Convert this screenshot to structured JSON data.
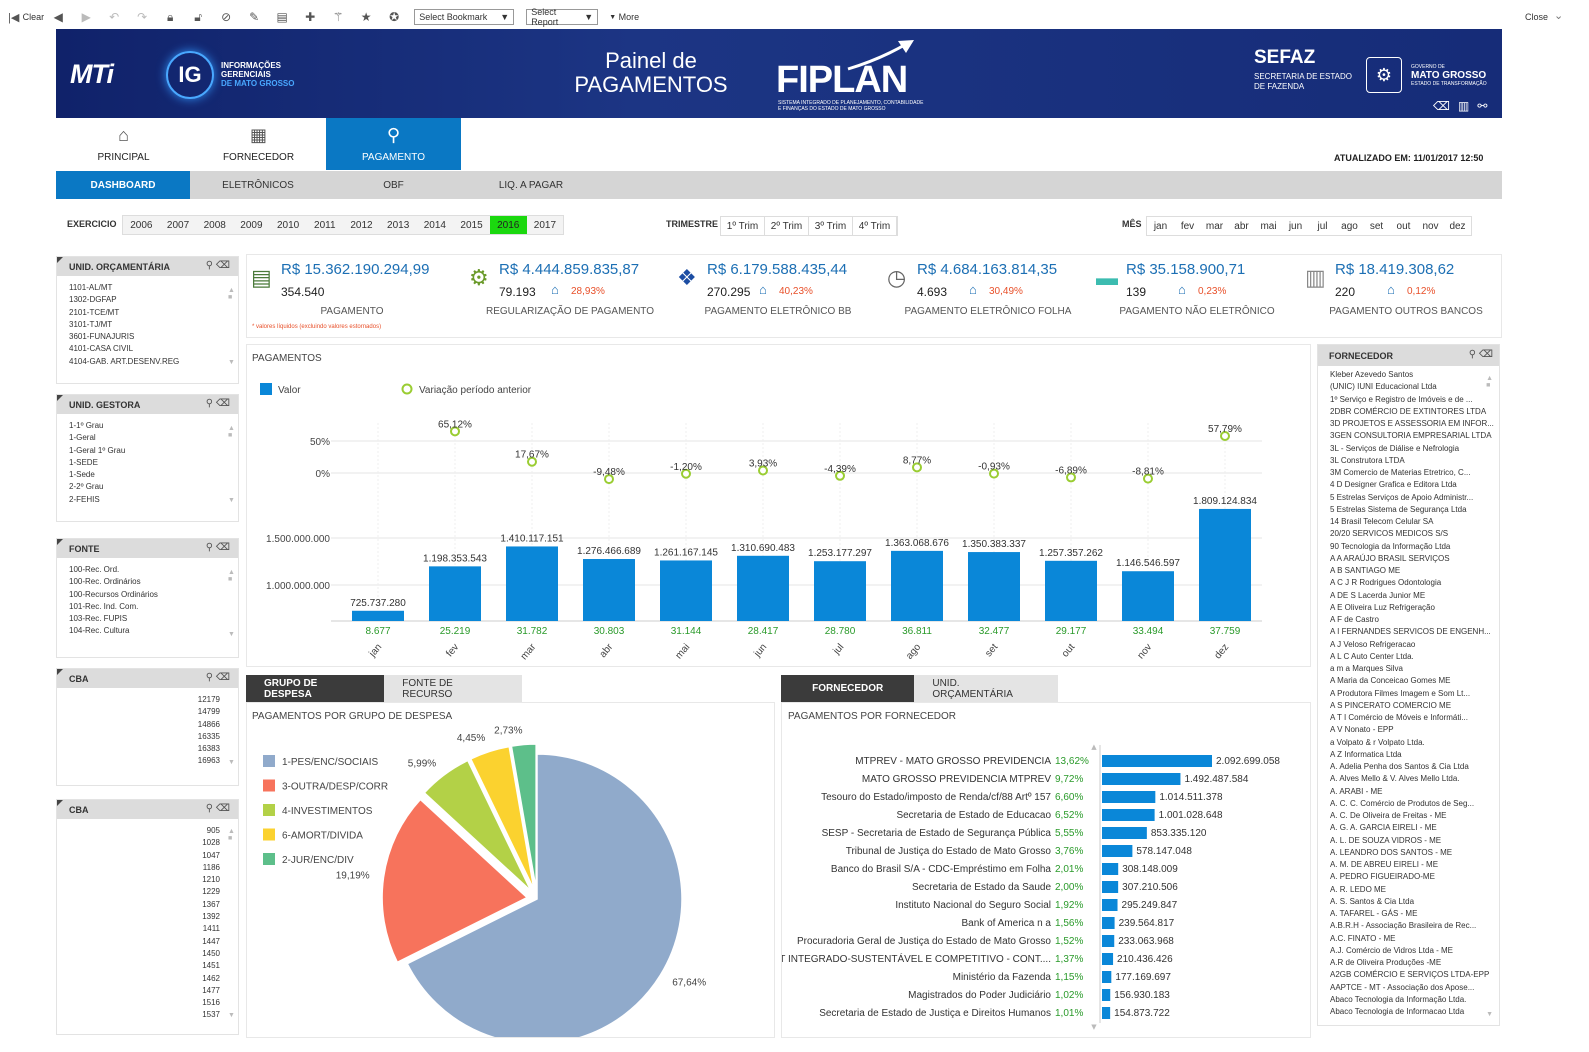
{
  "toolbar": {
    "clear_label": "Clear",
    "bookmark_select": "Select Bookmark",
    "report_select": "Select Report",
    "more_label": "More",
    "close_label": "Close"
  },
  "header": {
    "logo_text": "MTi",
    "ig_text": "IG",
    "ig_sub": [
      "INFORMAÇÕES",
      "GERENCIAIS",
      "DE MATO GROSSO"
    ],
    "title_line1": "Painel de",
    "title_line2": "PAGAMENTOS",
    "fiplan": "FIPLAN",
    "fiplan_sub": "SISTEMA INTEGRADO DE PLANEJAMENTO, CONTABILIDADE E FINANÇAS DO ESTADO DE MATO GROSSO",
    "sefaz": "SEFAZ",
    "sefaz_sub1": "SECRETARIA DE ESTADO",
    "sefaz_sub2": "DE FAZENDA",
    "mt_line1": "GOVERNO DE",
    "mt_line2": "MATO GROSSO",
    "mt_line3": "ESTADO DE TRANSFORMAÇÃO"
  },
  "nav": {
    "tabs": [
      {
        "label": "PRINCIPAL",
        "icon": "home-icon"
      },
      {
        "label": "FORNECEDOR",
        "icon": "building-icon"
      },
      {
        "label": "PAGAMENTO",
        "icon": "payment-icon"
      }
    ],
    "active": 2
  },
  "updated": "ATUALIZADO EM: 11/01/2017 12:50",
  "subnav": {
    "tabs": [
      "DASHBOARD",
      "ELETRÔNICOS",
      "OBF",
      "LIQ. A PAGAR"
    ],
    "active": 0
  },
  "filters": {
    "exercicio_label": "EXERCICIO",
    "years": [
      "2006",
      "2007",
      "2008",
      "2009",
      "2010",
      "2011",
      "2012",
      "2013",
      "2014",
      "2015",
      "2016",
      "2017"
    ],
    "selected_year": "2016",
    "trimestre_label": "TRIMESTRE",
    "trimestres": [
      "1º Trim",
      "2º Trim",
      "3º Trim",
      "4º Trim"
    ],
    "mes_label": "MÊS",
    "meses": [
      "jan",
      "fev",
      "mar",
      "abr",
      "mai",
      "jun",
      "jul",
      "ago",
      "set",
      "out",
      "nov",
      "dez"
    ]
  },
  "side": {
    "unid_orc": {
      "title": "UNID. ORÇAMENTÁRIA",
      "items": [
        "1101-AL/MT",
        "1302-DGFAP",
        "2101-TCE/MT",
        "3101-TJ/MT",
        "3601-FUNAJURIS",
        "4101-CASA CIVIL",
        "4104-GAB. ART.DESENV.REG"
      ]
    },
    "unid_gest": {
      "title": "UNID. GESTORA",
      "items": [
        "1-1º Grau",
        "1-Geral",
        "1-Geral 1º Grau",
        "1-SEDE",
        "1-Sede",
        "2-2º Grau",
        "2-FEHIS"
      ]
    },
    "fonte": {
      "title": "FONTE",
      "items": [
        "100-Rec. Ord.",
        "100-Rec. Ordinários",
        "100-Recursos Ordinários",
        "101-Rec. Ind. Com.",
        "103-Rec. FUPIS",
        "104-Rec. Cultura"
      ]
    },
    "cba1": {
      "title": "CBA",
      "items": [
        "12179",
        "14799",
        "14866",
        "16335",
        "16383",
        "16963"
      ]
    },
    "cba2": {
      "title": "CBA",
      "items": [
        "905",
        "1028",
        "1047",
        "1186",
        "1210",
        "1229",
        "1367",
        "1392",
        "1411",
        "1447",
        "1450",
        "1451",
        "1462",
        "1477",
        "1516",
        "1537"
      ]
    }
  },
  "kpis": [
    {
      "value": "R$ 15.362.190.294,99",
      "count": "354.540",
      "pct": "",
      "label": "PAGAMENTO",
      "icon": "document-money-icon"
    },
    {
      "value": "R$ 4.444.859.835,87",
      "count": "79.193",
      "pct": "28,93%",
      "label": "REGULARIZAÇÃO DE PAGAMENTO",
      "icon": "network-coin-icon"
    },
    {
      "value": "R$ 6.179.588.435,44",
      "count": "270.295",
      "pct": "40,23%",
      "label": "PAGAMENTO ELETRÔNICO BB",
      "icon": "bank-bb-icon"
    },
    {
      "value": "R$ 4.684.163.814,35",
      "count": "4.693",
      "pct": "30,49%",
      "label": "PAGAMENTO ELETRÔNICO FOLHA",
      "icon": "clock-payroll-icon"
    },
    {
      "value": "R$ 35.158.900,71",
      "count": "139",
      "pct": "0,23%",
      "label": "PAGAMENTO NÃO ELETRÔNICO",
      "icon": "cash-icon"
    },
    {
      "value": "R$ 18.419.308,62",
      "count": "220",
      "pct": "0,12%",
      "label": "PAGAMENTO OUTROS BANCOS",
      "icon": "bank-building-icon"
    }
  ],
  "kpi_note": "* valores líquidos (excluindo valores estornados)",
  "chart_data": [
    {
      "type": "bar",
      "title": "PAGAMENTOS",
      "legend": [
        "Valor",
        "Variação período anterior"
      ],
      "categories": [
        "jan",
        "fev",
        "mar",
        "abr",
        "mai",
        "jun",
        "jul",
        "ago",
        "set",
        "out",
        "nov",
        "dez"
      ],
      "values": [
        725737280,
        1198353543,
        1410117151,
        1276466689,
        1261167145,
        1310690483,
        1253177297,
        1363068676,
        1350383337,
        1257357262,
        1146546597,
        1809124834
      ],
      "value_labels": [
        "725.737.280",
        "1.198.353.543",
        "1.410.117.151",
        "1.276.466.689",
        "1.261.167.145",
        "1.310.690.483",
        "1.253.177.297",
        "1.363.068.676",
        "1.350.383.337",
        "1.257.357.262",
        "1.146.546.597",
        "1.809.124.834"
      ],
      "counts": [
        "8.677",
        "25.219",
        "31.782",
        "30.803",
        "31.144",
        "28.417",
        "28.780",
        "36.811",
        "32.477",
        "29.177",
        "33.494",
        "37.759"
      ],
      "variation": [
        null,
        65.12,
        17.67,
        -9.48,
        -1.2,
        3.93,
        -4.39,
        8.77,
        -0.93,
        -6.89,
        -8.81,
        57.79
      ],
      "variation_labels": [
        "",
        "65,12%",
        "17,67%",
        "-9,48%",
        "-1,20%",
        "3,93%",
        "-4,39%",
        "8,77%",
        "-0,93%",
        "-6,89%",
        "-8,81%",
        "57,79%"
      ],
      "yticks_value": [
        "1.000.000.000",
        "1.500.000.000"
      ],
      "yticks_pct": [
        "0%",
        "50%"
      ],
      "colors": {
        "bar": "#0a87d8",
        "variation": "#9acd32"
      }
    },
    {
      "type": "pie",
      "title": "PAGAMENTOS POR GRUPO DE DESPESA",
      "slices": [
        {
          "name": "1-PES/ENC/SOCIAIS",
          "value": 67.64,
          "label": "67,64%",
          "color": "#90aacb"
        },
        {
          "name": "3-OUTRA/DESP/CORR",
          "value": 19.19,
          "label": "19,19%",
          "color": "#f7735c"
        },
        {
          "name": "4-INVESTIMENTOS",
          "value": 5.99,
          "label": "5,99%",
          "color": "#b3d147"
        },
        {
          "name": "6-AMORT/DIVIDA",
          "value": 4.45,
          "label": "4,45%",
          "color": "#fbd22f"
        },
        {
          "name": "2-JUR/ENC/DIV",
          "value": 2.73,
          "label": "2,73%",
          "color": "#5dbf8a"
        }
      ]
    },
    {
      "type": "bar",
      "title": "PAGAMENTOS POR FORNECEDOR",
      "orientation": "horizontal",
      "rows": [
        {
          "name": "MTPREV - MATO GROSSO PREVIDENCIA",
          "pct": "13,62%",
          "value": 2092699058,
          "label": "2.092.699.058"
        },
        {
          "name": "MATO GROSSO PREVIDENCIA MTPREV",
          "pct": "9,72%",
          "value": 1492487584,
          "label": "1.492.487.584"
        },
        {
          "name": "Tesouro do Estado/imposto de Renda/cf/88 Artº 157",
          "pct": "6,60%",
          "value": 1014511378,
          "label": "1.014.511.378"
        },
        {
          "name": "Secretaria de Estado de Educacao",
          "pct": "6,52%",
          "value": 1001028648,
          "label": "1.001.028.648"
        },
        {
          "name": "SESP - Secretaria de Estado de Segurança Pública",
          "pct": "5,55%",
          "value": 853335120,
          "label": "853.335.120"
        },
        {
          "name": "Tribunal de Justiça do Estado de Mato Grosso",
          "pct": "3,76%",
          "value": 578147048,
          "label": "578.147.048"
        },
        {
          "name": "Banco do Brasil S/A - CDC-Empréstimo em Folha",
          "pct": "2,01%",
          "value": 308148009,
          "label": "308.148.009"
        },
        {
          "name": "Secretaria de Estado da Saude",
          "pct": "2,00%",
          "value": 307210506,
          "label": "307.210.506"
        },
        {
          "name": "Instituto Nacional do Seguro Social",
          "pct": "1,92%",
          "value": 295249847,
          "label": "295.249.847"
        },
        {
          "name": "Bank of America n a",
          "pct": "1,56%",
          "value": 239564817,
          "label": "239.564.817"
        },
        {
          "name": "Procuradoria Geral de Justiça do Estado de Mato Grosso",
          "pct": "1,52%",
          "value": 233063968,
          "label": "233.063.968"
        },
        {
          "name": "MT INTEGRADO-SUSTENTÁVEL E COMPETITIVO - CONT....",
          "pct": "1,37%",
          "value": 210436426,
          "label": "210.436.426"
        },
        {
          "name": "Ministério da Fazenda",
          "pct": "1,15%",
          "value": 177169697,
          "label": "177.169.697"
        },
        {
          "name": "Magistrados do Poder Judiciário",
          "pct": "1,02%",
          "value": 156930183,
          "label": "156.930.183"
        },
        {
          "name": "Secretaria de Estado de Justiça e Direitos Humanos",
          "pct": "1,01%",
          "value": 154873722,
          "label": "154.873.722"
        }
      ],
      "colors": {
        "bar": "#0a87d8",
        "pct": "#2a9a2a"
      }
    }
  ],
  "lower_left": {
    "tabs": [
      "GRUPO DE DESPESA",
      "FONTE DE RECURSO"
    ],
    "active": 0,
    "title": "PAGAMENTOS POR GRUPO DE DESPESA"
  },
  "lower_right": {
    "tabs": [
      "FORNECEDOR",
      "UNID. ORÇAMENTÁRIA"
    ],
    "active": 0,
    "title": "PAGAMENTOS POR FORNECEDOR"
  },
  "fornecedor_list": {
    "title": "FORNECEDOR",
    "items": [
      "Kleber Azevedo Santos",
      "(UNIC) IUNI Educacional Ltda",
      "1º Serviço e Registro de Imóveis e de ...",
      "2DBR COMÉRCIO DE EXTINTORES LTDA",
      "3D PROJETOS E ASSESSORIA EM INFOR...",
      "3GEN CONSULTORIA EMPRESARIAL LTDA",
      "3L - Serviços de Diálise e Nefrologia",
      "3L Construtora LTDA",
      "3M Comercio de Materias Etretrico, C...",
      "4 D Designer Grafica e Editora Ltda",
      "5 Estrelas Serviços de Apoio Administr...",
      "5 Estrelas Sistema de Segurança Ltda",
      "14 Brasil Telecom Celular SA",
      "20/20 SERVICOS MEDICOS S/S",
      "90 Tecnologia da Informação Ltda",
      "A A ARAÚJO BRASIL SERVIÇOS",
      "A B SANTIAGO ME",
      "A C J R Rodrigues Odontologia",
      "A DE S Lacerda Junior ME",
      "A E Oliveira Luz Refrigeração",
      "A F de Castro",
      "A I FERNANDES SERVICOS DE ENGENH...",
      "A J Veloso Refrigeracao",
      "A L C Auto Center Ltda.",
      "a m a Marques Silva",
      "A Maria da Conceicao Gomes ME",
      "A Produtora Filmes Imagem e Som Lt...",
      "A S PINCERATO COMERCIO ME",
      "A T I Comércio de Móveis e Informáti...",
      "A V Nonato - EPP",
      "a Volpato & r Volpato Ltda.",
      "A Z Informatica Ltda",
      "A. Adelia Penha dos Santos & Cia Ltda",
      "A. Alves Mello & V. Alves Mello Ltda.",
      "A. ARABI - ME",
      "A. C. C. Comércio de Produtos de Seg...",
      "A. C. De Oliveira de Freitas - ME",
      "A. G. A. GARCIA EIRELI - ME",
      "A. L. DE SOUZA VIDROS - ME",
      "A. LEANDRO DOS SANTOS - ME",
      "A. M. DE ABREU EIRELI - ME",
      "A. PEDRO FIGUEIRADO-ME",
      "A. R. LEDO ME",
      "A. S. Santos & Cia Ltda",
      "A. TAFAREL - GÁS - ME",
      "A.B.R.H - Associação Brasileira de Rec...",
      "A.C. FINATO - ME",
      "A.J. Comércio de Vidros Ltda - ME",
      "A.R de Oliveira Produções -ME",
      "A2GB COMÉRCIO E SERVIÇOS LTDA-EPP",
      "AAPTCE - MT - Associação dos Apose...",
      "Abaco Tecnologia da Informação Ltda.",
      "Abaco Tecnologia de Informacao Ltda"
    ]
  }
}
